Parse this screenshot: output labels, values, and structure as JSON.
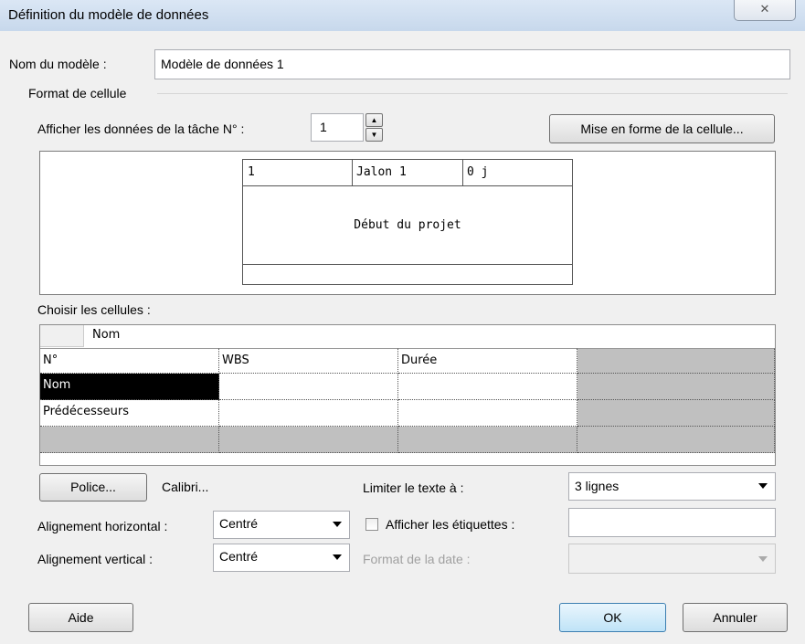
{
  "window": {
    "title": "Définition du modèle de données",
    "close_glyph": "✕"
  },
  "model_name": {
    "label": "Nom du modèle :",
    "value": "Modèle de données 1"
  },
  "cell_format": {
    "group_label": "Format de cellule",
    "task_label": "Afficher les données de la tâche N° :",
    "task_number": "1",
    "format_button": "Mise en forme de la cellule..."
  },
  "preview": {
    "id": "1",
    "name": "Jalon 1",
    "duration": "0 j",
    "center_text": "Début du projet"
  },
  "cells": {
    "label": "Choisir les cellules :",
    "editor_value": "Nom",
    "rows": [
      [
        "N°",
        "WBS",
        "Durée",
        ""
      ],
      [
        "Nom",
        "",
        "",
        ""
      ],
      [
        "Prédécesseurs",
        "",
        "",
        ""
      ],
      [
        "",
        "",
        "",
        ""
      ]
    ],
    "selected": "Nom"
  },
  "font": {
    "button": "Police...",
    "name": "Calibri..."
  },
  "limit_text": {
    "label": "Limiter le texte à :",
    "value": "3 lignes"
  },
  "h_align": {
    "label": "Alignement horizontal :",
    "value": "Centré"
  },
  "v_align": {
    "label": "Alignement vertical :",
    "value": "Centré"
  },
  "show_labels": {
    "label": "Afficher les étiquettes :",
    "checked": false,
    "value": ""
  },
  "date_format": {
    "label": "Format de la date :",
    "value": ""
  },
  "footer": {
    "help": "Aide",
    "ok": "OK",
    "cancel": "Annuler"
  }
}
